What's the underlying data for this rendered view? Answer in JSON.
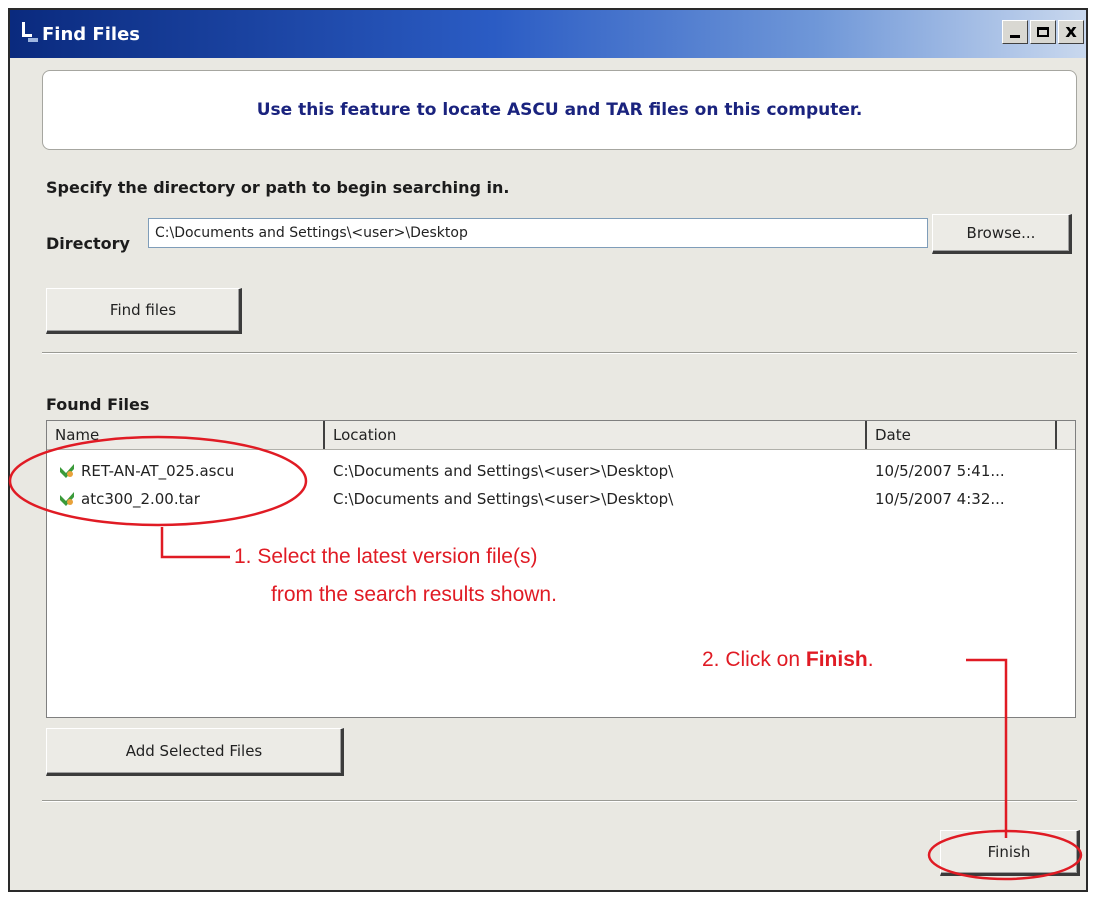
{
  "window": {
    "title": "Find Files",
    "controls": {
      "minimize": "_",
      "maximize": "□",
      "close": "x"
    }
  },
  "banner": {
    "text": "Use this feature to locate ASCU and TAR files on this computer."
  },
  "search": {
    "instruction": "Specify the directory or path to begin searching in.",
    "directory_label": "Directory",
    "directory_value": "C:\\Documents and Settings\\<user>\\Desktop",
    "browse_label": "Browse...",
    "find_label": "Find files"
  },
  "found": {
    "label": "Found Files",
    "columns": [
      "Name",
      "Location",
      "Date"
    ],
    "rows": [
      {
        "name": "RET-AN-AT_025.ascu",
        "location": "C:\\Documents and Settings\\<user>\\Desktop\\",
        "date": "10/5/2007 5:41..."
      },
      {
        "name": "atc300_2.00.tar",
        "location": "C:\\Documents and Settings\\<user>\\Desktop\\",
        "date": "10/5/2007 4:32..."
      }
    ]
  },
  "actions": {
    "add_selected_label": "Add Selected Files",
    "finish_label": "Finish"
  },
  "annotations": {
    "step1_line1": "1.  Select the latest version file(s)",
    "step1_line2": "from the search results shown.",
    "step2_prefix": "2.  Click on ",
    "step2_bold": "Finish",
    "step2_suffix": "."
  },
  "colors": {
    "annotation_red": "#e01b24",
    "title_blue": "#0a2a7e",
    "banner_text": "#1a237e"
  }
}
